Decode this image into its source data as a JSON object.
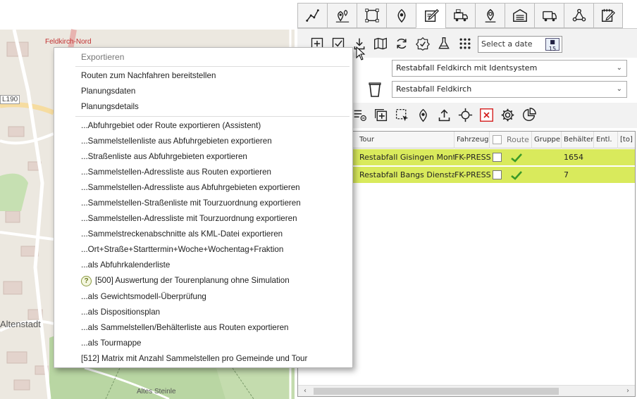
{
  "map": {
    "labels": {
      "feldkirch_nord": "Feldkirch-Nord",
      "l190": "L190",
      "altenstadt": "Altenstadt",
      "altes_steinle": "Altes Steinle"
    }
  },
  "tabs": [
    {
      "icon": "route-line-icon"
    },
    {
      "icon": "map-pins-icon"
    },
    {
      "icon": "selection-frame-icon"
    },
    {
      "icon": "location-shield-icon"
    },
    {
      "icon": "edit-note-icon"
    },
    {
      "icon": "garbage-truck-icon"
    },
    {
      "icon": "map-pin-icon"
    },
    {
      "icon": "depot-building-icon"
    },
    {
      "icon": "vehicle-icon"
    },
    {
      "icon": "network-icon"
    },
    {
      "icon": "notepad-edit-icon"
    }
  ],
  "toolbar1": {
    "date_placeholder": "Select a date",
    "calendar_day": "15"
  },
  "selects": {
    "fraction": "Restabfall Feldkirch mit Identsystem",
    "planning": "Restabfall Feldkirch"
  },
  "grid": {
    "headers": [
      "Tour",
      "Fahrzeug",
      "Route",
      "Gruppe",
      "Behälter",
      "Entl.",
      "[to]"
    ],
    "rows": [
      {
        "tour": "Restabfall Gisingen Montag",
        "fahrzeug": "FK-PRESS",
        "behaelter": "1654"
      },
      {
        "tour": "Restabfall Bangs Dienstag",
        "fahrzeug": "FK-PRESS",
        "behaelter": "7"
      }
    ]
  },
  "menu": {
    "header": "Exportieren",
    "group1": [
      "Routen zum Nachfahren bereitstellen",
      "Planungsdaten",
      "Planungsdetails"
    ],
    "group2": [
      "...Abfuhrgebiet oder Route exportieren (Assistent)",
      "...Sammelstellenliste aus Abfuhrgebieten exportieren",
      "...Straßenliste aus Abfuhrgebieten exportieren",
      "...Sammelstellen-Adressliste aus Routen exportieren",
      "...Sammelstellen-Adressliste aus Abfuhrgebieten exportieren",
      "...Sammelstellen-Straßenliste mit Tourzuordnung exportieren",
      "...Sammelstellen-Adressliste mit Tourzuordnung exportieren",
      "...Sammelstreckenabschnitte als KML-Datei exportieren",
      "...Ort+Straße+Starttermin+Woche+Wochentag+Fraktion",
      "...als Abfuhrkalenderliste",
      "[500] Auswertung der Tourenplanung ohne Simulation",
      "...als Gewichtsmodell-Überprüfung",
      "...als Dispositionsplan",
      "...als Sammelstellen/Behälterliste aus Routen exportieren",
      "...als Tourmappe",
      "[512] Matrix mit Anzahl Sammelstellen pro Gemeinde und Tour"
    ]
  },
  "colors": {
    "row_highlight": "#d9ea5c",
    "check_green": "#3a9a28",
    "delete_red": "#d42020",
    "map_label_red": "#c03030"
  }
}
